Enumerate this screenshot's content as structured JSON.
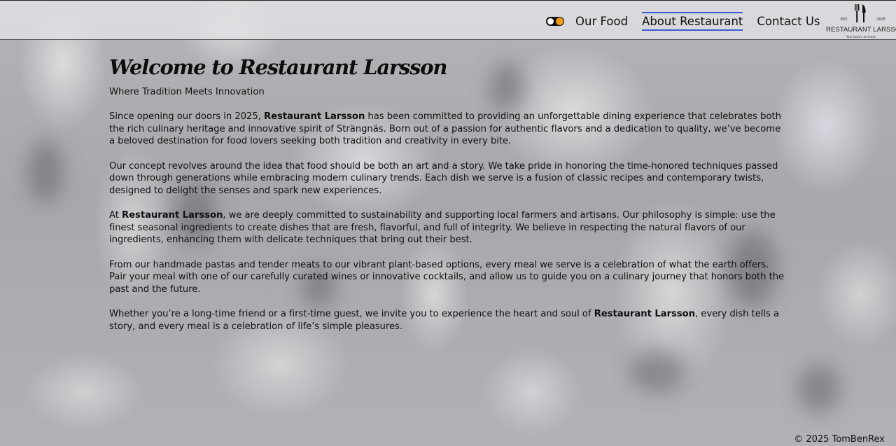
{
  "nav": {
    "theme_toggle": "theme-toggle",
    "links": [
      "Our Food",
      "About Restaurant",
      "Contact Us"
    ],
    "active_index": 1
  },
  "logo": {
    "est": "EST.",
    "year": "2025",
    "name": "RESTAURANT LARSSON",
    "tagline": "Your taste's at needs"
  },
  "main": {
    "title": "Welcome to Restaurant Larsson",
    "subtitle": "Where Tradition Meets Innovation",
    "p1": {
      "before": "Since opening our doors in 2025, ",
      "bold": "Restaurant Larsson",
      "after": " has been committed to providing an unforgettable dining experience that celebrates both the rich culinary heritage and innovative spirit of Strängnäs. Born out of a passion for authentic flavors and a dedication to quality, we’ve become a beloved destination for food lovers seeking both tradition and creativity in every bite."
    },
    "p2": "Our concept revolves around the idea that food should be both an art and a story. We take pride in honoring the time-honored techniques passed down through generations while embracing modern culinary trends. Each dish we serve is a fusion of classic recipes and contemporary twists, designed to delight the senses and spark new experiences.",
    "p3": {
      "before": "At ",
      "bold": "Restaurant Larsson",
      "after": ", we are deeply committed to sustainability and supporting local farmers and artisans. Our philosophy is simple: use the finest seasonal ingredients to create dishes that are fresh, flavorful, and full of integrity. We believe in respecting the natural flavors of our ingredients, enhancing them with delicate techniques that bring out their best."
    },
    "p4": "From our handmade pastas and tender meats to our vibrant plant-based options, every meal we serve is a celebration of what the earth offers. Pair your meal with one of our carefully curated wines or innovative cocktails, and allow us to guide you on a culinary journey that honors both the past and the future.",
    "p5": {
      "before": "Whether you’re a long-time friend or a first-time guest, we invite you to experience the heart and soul of ",
      "bold": "Restaurant Larsson",
      "after": ", every dish tells a story, and every meal is a celebration of life’s simple pleasures."
    }
  },
  "footer": {
    "copyright": "© 2025 TomBenRex"
  },
  "colors": {
    "active_underline": "#3c5bd8",
    "toggle_sun": "#f0a020"
  }
}
